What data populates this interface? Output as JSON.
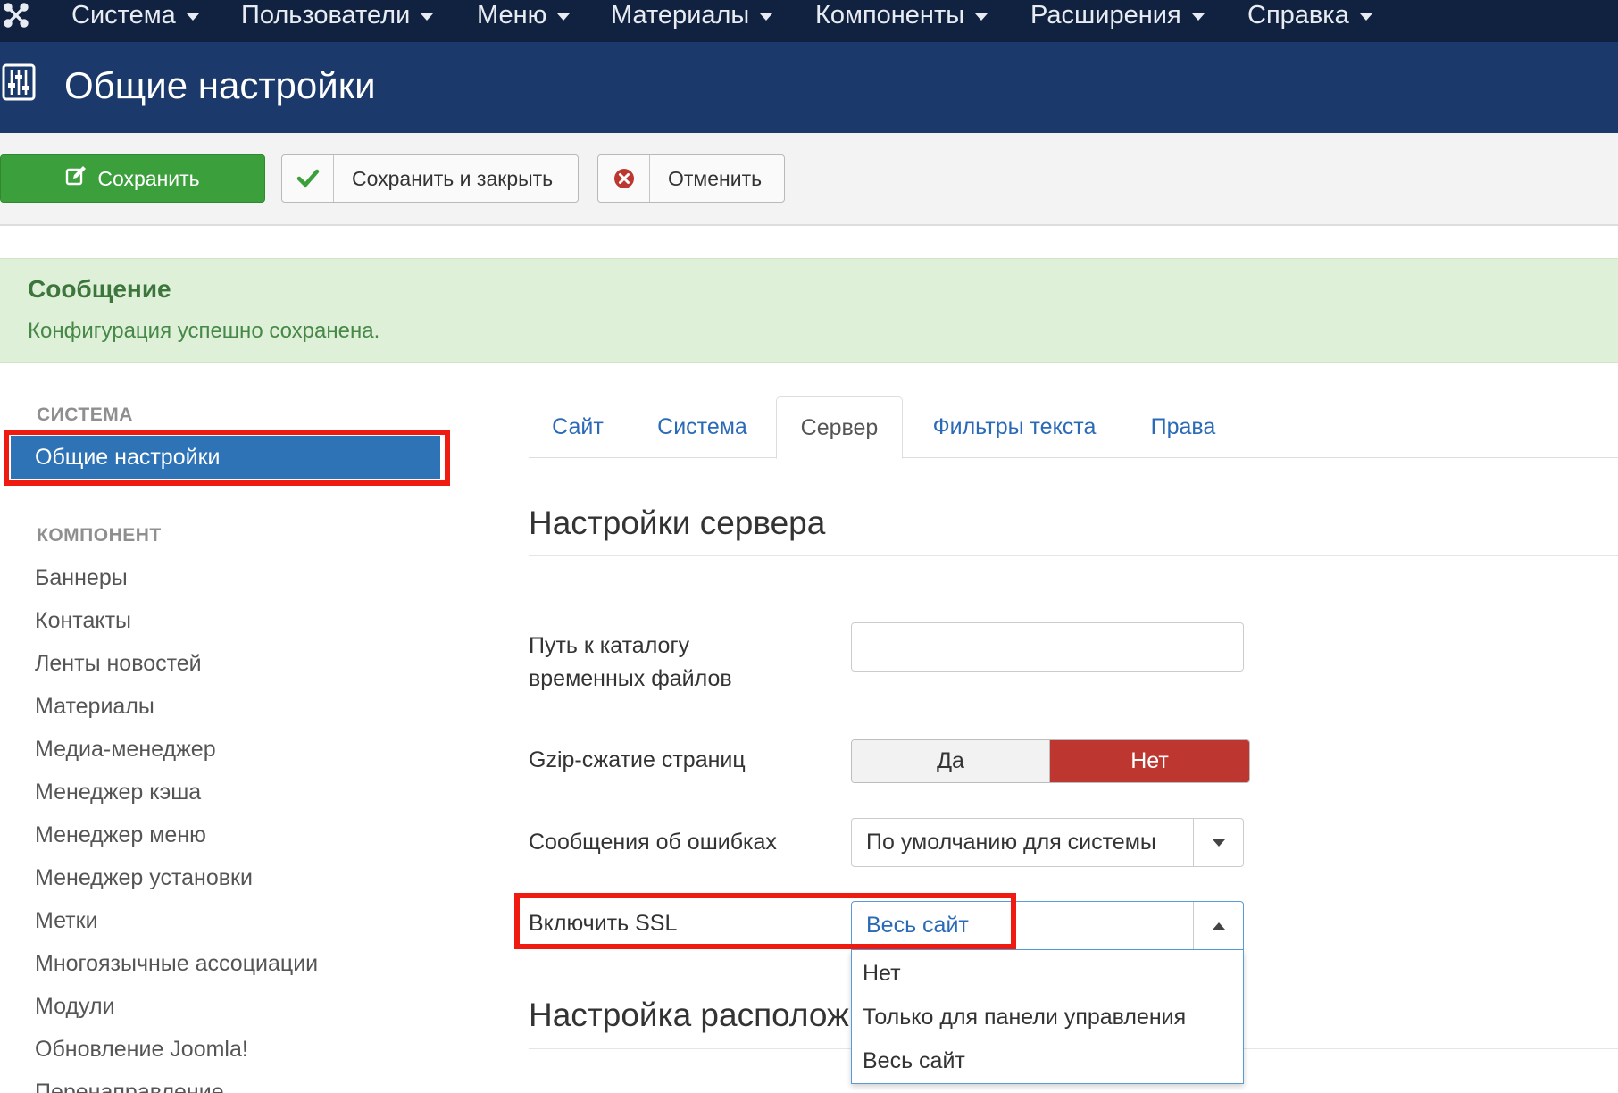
{
  "topnav": {
    "items": [
      {
        "label": "Система"
      },
      {
        "label": "Пользователи"
      },
      {
        "label": "Меню"
      },
      {
        "label": "Материалы"
      },
      {
        "label": "Компоненты"
      },
      {
        "label": "Расширения"
      },
      {
        "label": "Справка"
      }
    ]
  },
  "header": {
    "title": "Общие настройки"
  },
  "toolbar": {
    "save_label": "Сохранить",
    "save_close_label": "Сохранить и закрыть",
    "cancel_label": "Отменить"
  },
  "message": {
    "title": "Сообщение",
    "text": "Конфигурация успешно сохранена."
  },
  "sidebar": {
    "system_heading": "СИСТЕМА",
    "active_item": "Общие настройки",
    "component_heading": "КОМПОНЕНТ",
    "items": [
      {
        "label": "Баннеры"
      },
      {
        "label": "Контакты"
      },
      {
        "label": "Ленты новостей"
      },
      {
        "label": "Материалы"
      },
      {
        "label": "Медиа-менеджер"
      },
      {
        "label": "Менеджер кэша"
      },
      {
        "label": "Менеджер меню"
      },
      {
        "label": "Менеджер установки"
      },
      {
        "label": "Метки"
      },
      {
        "label": "Многоязычные ассоциации"
      },
      {
        "label": "Модули"
      },
      {
        "label": "Обновление Joomla!"
      },
      {
        "label": "Перенаправление"
      }
    ]
  },
  "tabs": [
    {
      "label": "Сайт"
    },
    {
      "label": "Система"
    },
    {
      "label": "Сервер"
    },
    {
      "label": "Фильтры текста"
    },
    {
      "label": "Права"
    }
  ],
  "form": {
    "section_title": "Настройки сервера",
    "temp_path_label": "Путь к каталогу временных файлов",
    "temp_path_label_line1": "Путь к каталогу",
    "temp_path_label_line2": "временных файлов",
    "temp_path_value": "",
    "gzip_label": "Gzip-сжатие страниц",
    "gzip_yes": "Да",
    "gzip_no": "Нет",
    "errors_label": "Сообщения об ошибках",
    "errors_value": "По умолчанию для системы",
    "ssl_label": "Включить SSL",
    "ssl_value": "Весь сайт",
    "ssl_options": [
      {
        "label": "Нет"
      },
      {
        "label": "Только для панели управления"
      },
      {
        "label": "Весь сайт"
      }
    ],
    "section2_title": "Настройка располож"
  },
  "colors": {
    "topnav_bg": "#10223f",
    "header_bg": "#1b3a6b",
    "save_green": "#3b9f3b",
    "active_blue": "#2f73b7",
    "toggle_no_red": "#bd362f",
    "highlight_red": "#f01b10",
    "message_bg": "#dff0d8"
  },
  "icons": {
    "logo": "joomla-logo-icon",
    "header": "sliders-icon",
    "save": "edit-icon",
    "save_close": "check-icon",
    "cancel": "cancel-circle-icon"
  }
}
